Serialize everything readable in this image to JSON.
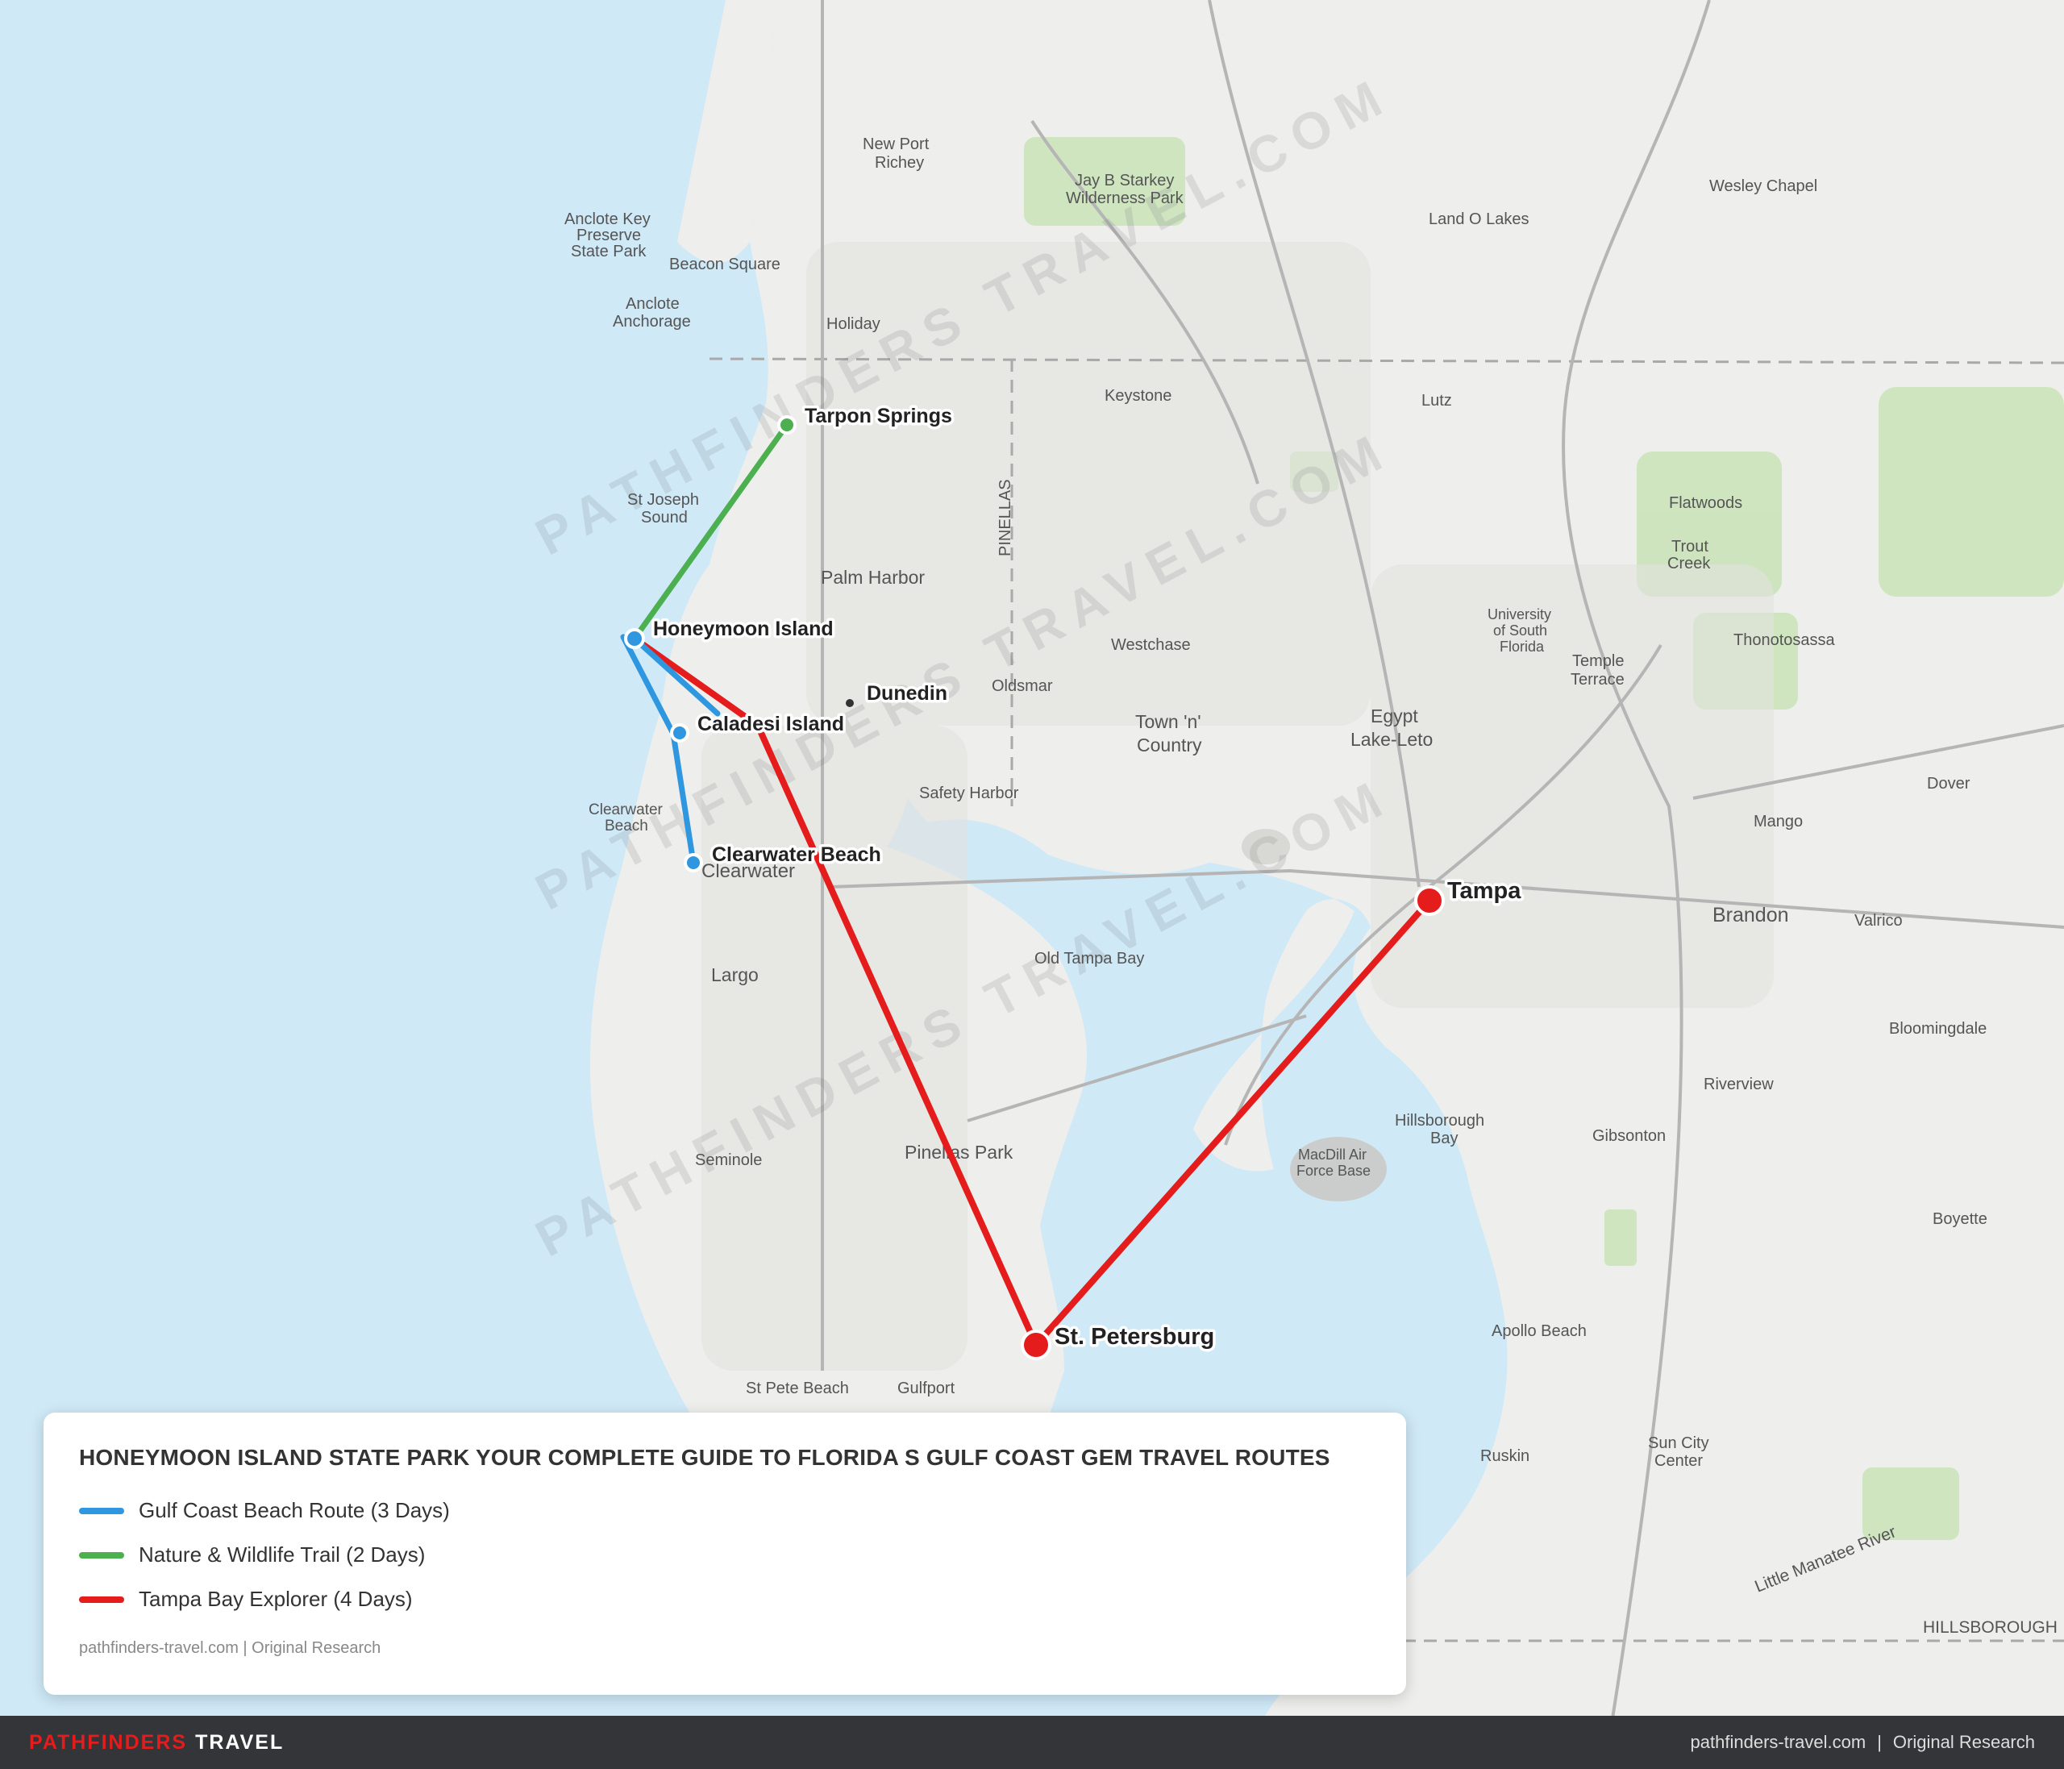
{
  "legend": {
    "title": "HONEYMOON ISLAND STATE PARK YOUR COMPLETE GUIDE TO FLORIDA S GULF COAST GEM TRAVEL ROUTES",
    "routes": [
      {
        "label": "Gulf Coast Beach Route (3 Days)",
        "color": "#2f96e0"
      },
      {
        "label": "Nature & Wildlife Trail (2 Days)",
        "color": "#4caf50"
      },
      {
        "label": "Tampa Bay Explorer (4 Days)",
        "color": "#e41c1c"
      }
    ],
    "source": "pathfinders-travel.com | Original Research"
  },
  "stops": {
    "tarpon_springs": "Tarpon Springs",
    "honeymoon_island": "Honeymoon Island",
    "caladesi_island": "Caladesi Island",
    "clearwater_beach": "Clearwater Beach",
    "dunedin": "Dunedin",
    "tampa": "Tampa",
    "st_petersburg": "St. Petersburg"
  },
  "places": {
    "new_port_richey_1": "New Port",
    "new_port_richey_2": "Richey",
    "beacon_square": "Beacon Square",
    "holiday": "Holiday",
    "anclote_key_1": "Anclote Key",
    "anclote_key_2": "Preserve",
    "anclote_key_3": "State Park",
    "anclote_anch_1": "Anclote",
    "anclote_anch_2": "Anchorage",
    "st_joseph_1": "St Joseph",
    "st_joseph_2": "Sound",
    "palm_harbor": "Palm Harbor",
    "keystone": "Keystone",
    "lutz": "Lutz",
    "land_o_lakes": "Land O Lakes",
    "wesley_chapel": "Wesley Chapel",
    "jay_starkey_1": "Jay B Starkey",
    "jay_starkey_2": "Wilderness Park",
    "westchase": "Westchase",
    "oldsmar": "Oldsmar",
    "town_country_1": "Town 'n'",
    "town_country_2": "Country",
    "egypt_1": "Egypt",
    "egypt_2": "Lake-Leto",
    "safety_harbor": "Safety Harbor",
    "old_tampa_bay": "Old Tampa Bay",
    "largo": "Largo",
    "seminole": "Seminole",
    "pinellas_park": "Pinellas Park",
    "brandon": "Brandon",
    "valrico": "Valrico",
    "mango": "Mango",
    "dover": "Dover",
    "thonotosassa": "Thonotosassa",
    "temple_1": "Temple",
    "temple_2": "Terrace",
    "usf_1": "University",
    "usf_2": "of South",
    "usf_3": "Florida",
    "hillsborough_bay_1": "Hillsborough",
    "hillsborough_bay_2": "Bay",
    "macdill_1": "MacDill Air",
    "macdill_2": "Force Base",
    "gibsonton": "Gibsonton",
    "riverview": "Riverview",
    "bloomingdale": "Bloomingdale",
    "boyette": "Boyette",
    "apollo_beach": "Apollo Beach",
    "ruskin": "Ruskin",
    "sun_city_1": "Sun City",
    "sun_city_2": "Center",
    "st_pete_beach": "St Pete Beach",
    "gulfport": "Gulfport",
    "flatwoods": "Flatwoods",
    "trout_creek_1": "Trout",
    "trout_creek_2": "Creek",
    "clearwater": "Clearwater",
    "clearwater_beach_town_1": "Clearwater",
    "clearwater_beach_town_2": "Beach",
    "hillsborough_county": "HILLSBOROUGH",
    "pinellas_county": "PINELLAS",
    "little_manatee_river": "Little Manatee River"
  },
  "watermark": "PATHFINDERS TRAVEL.COM",
  "footer": {
    "brand_a": "PATHFINDERS",
    "brand_b": "TRAVEL",
    "site": "pathfinders-travel.com",
    "note": "Original Research"
  }
}
